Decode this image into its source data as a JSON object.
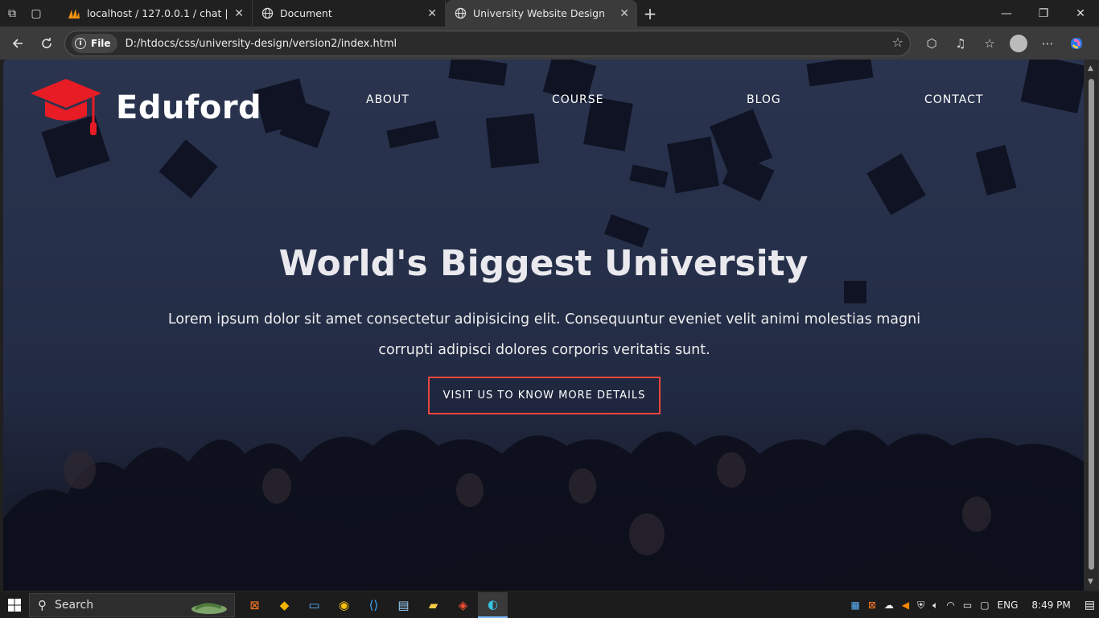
{
  "browser": {
    "tabs": [
      {
        "title": "localhost / 127.0.0.1 / chat | phpM",
        "close": "✕",
        "icon": "phpmyadmin-icon"
      },
      {
        "title": "Document",
        "close": "✕",
        "icon": "globe-icon"
      },
      {
        "title": "University Website Design",
        "close": "✕",
        "icon": "globe-icon",
        "active": true
      }
    ],
    "new_tab": "+",
    "address_chip": "File",
    "url": "D:/htdocs/css/university-design/version2/index.html",
    "window_controls": {
      "minimize": "—",
      "restore": "❐",
      "close": "✕"
    }
  },
  "page": {
    "brand": "Eduford",
    "nav": [
      "ABOUT",
      "COURSE",
      "BLOG",
      "CONTACT"
    ],
    "hero_title": "World's Biggest University",
    "hero_text": "Lorem ipsum dolor sit amet consectetur adipisicing elit. Consequuntur eveniet velit animi molestias magni corrupti adipisci dolores corporis veritatis sunt.",
    "cta": "VISIT US TO KNOW MORE DETAILS",
    "colors": {
      "accent": "#e8463c",
      "logo": "#e81c24"
    }
  },
  "taskbar": {
    "search_placeholder": "Search",
    "language": "ENG",
    "time": "8:49 PM"
  }
}
